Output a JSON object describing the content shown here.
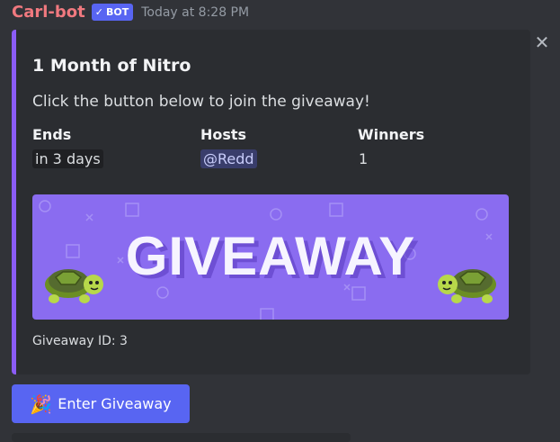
{
  "message": {
    "author": "Carl-bot",
    "bot_tag": "BOT",
    "bot_check_icon": "check-icon",
    "timestamp": "Today at 8:28 PM"
  },
  "embed": {
    "accent_color": "#8b5cf6",
    "title": "1 Month of Nitro",
    "description": "Click the button below to join the giveaway!",
    "fields": [
      {
        "name": "Ends",
        "value": "in 3 days"
      },
      {
        "name": "Hosts",
        "value": "@Redd"
      },
      {
        "name": "Winners",
        "value": "1"
      }
    ],
    "banner_text": "GIVEAWAY",
    "banner_color": "#8a6cf0",
    "footer": "Giveaway ID: 3"
  },
  "close_icon": "close-icon",
  "button": {
    "label": "Enter Giveaway",
    "icon": "party-popper-icon",
    "color": "#5865f2"
  }
}
